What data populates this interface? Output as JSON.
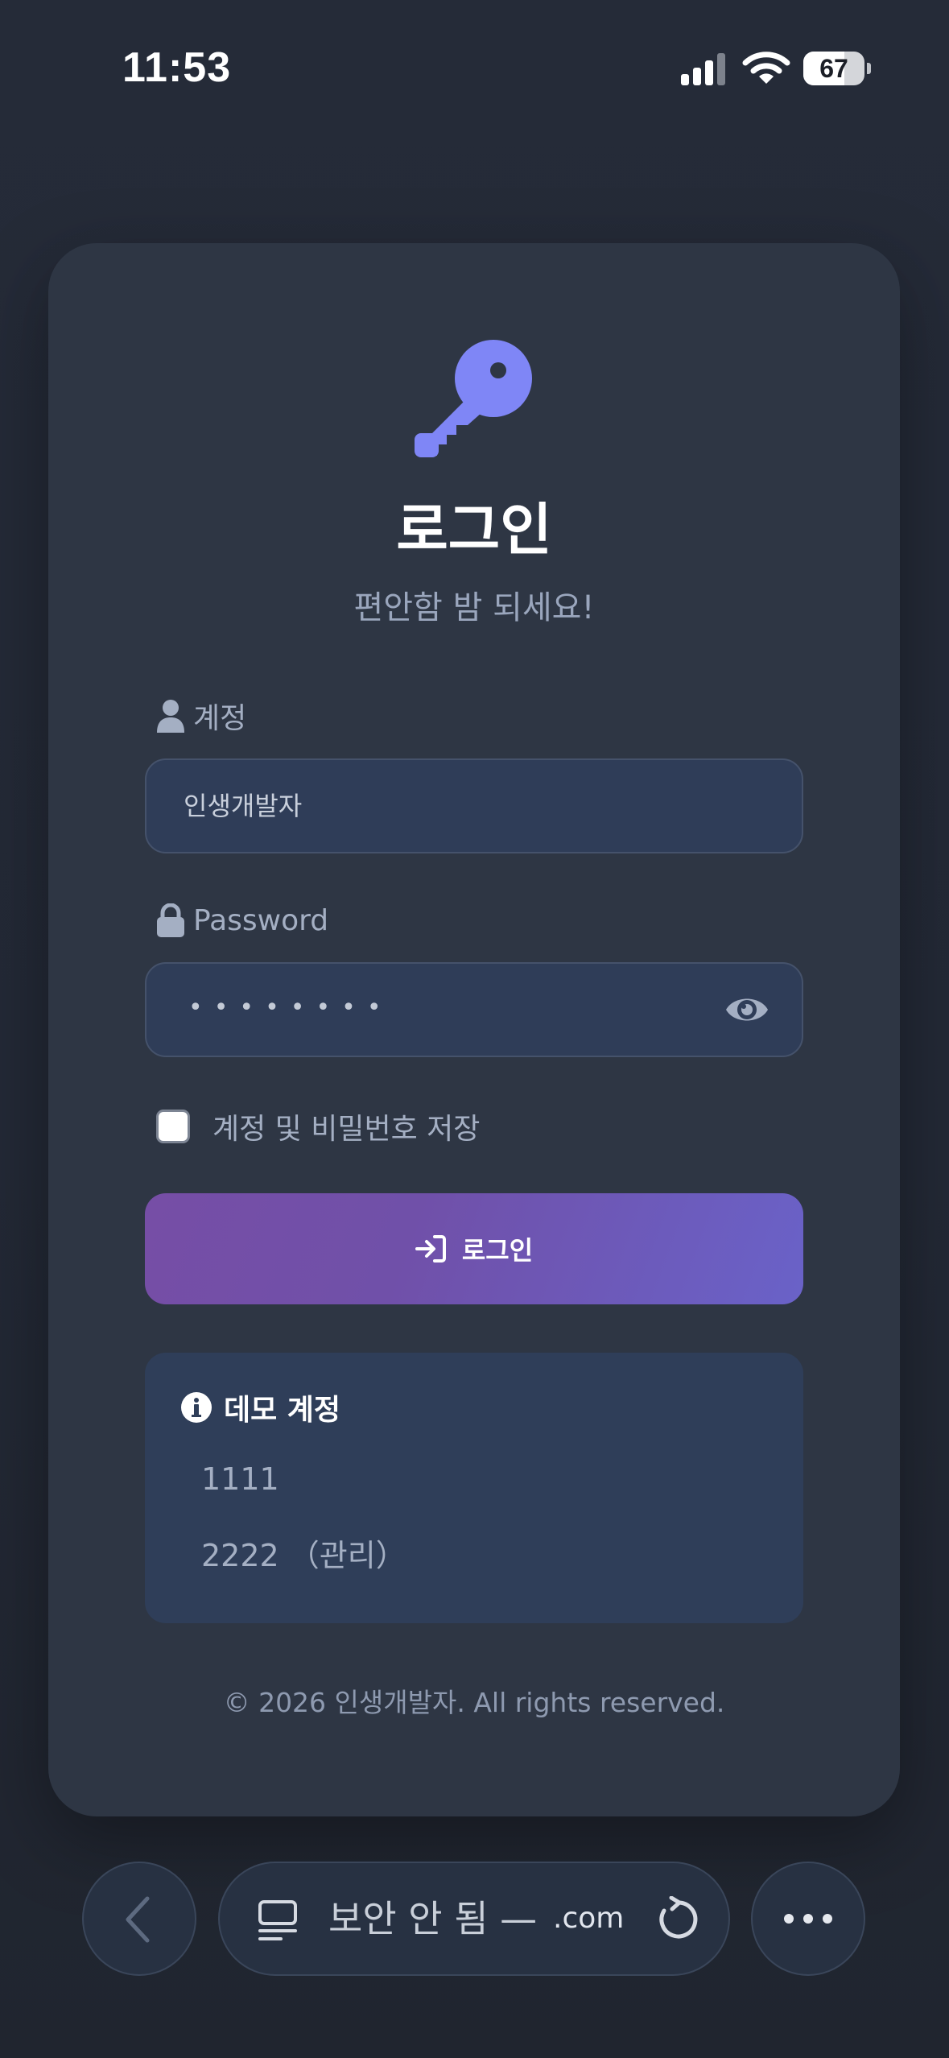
{
  "status_bar": {
    "time": "11:53",
    "battery_level": "67",
    "battery_fraction": 0.67
  },
  "login_card": {
    "icon": "key-icon",
    "title": "로그인",
    "subtitle": "편안함 밤 되세요!",
    "account_label": "계정",
    "account_value": "인생개발자",
    "password_label": "Password",
    "password_masked": "••••••••",
    "remember_label": "계정 및 비밀번호 저장",
    "remember_checked": false,
    "login_button_label": "로그인",
    "demo": {
      "title": "데모 계정",
      "accounts": [
        "1111",
        "2222 （관리）"
      ]
    },
    "footer": "© 2026 인생개발자. All rights reserved."
  },
  "browser_bar": {
    "security_text": "보안 안 됨 —",
    "domain_text": ".com"
  },
  "colors": {
    "background": "#222835",
    "card": "#2e3644",
    "input": "#2f3d58",
    "accent": "#7f86f6",
    "button_gradient_start": "#764ea6",
    "button_gradient_end": "#6a62c8"
  }
}
